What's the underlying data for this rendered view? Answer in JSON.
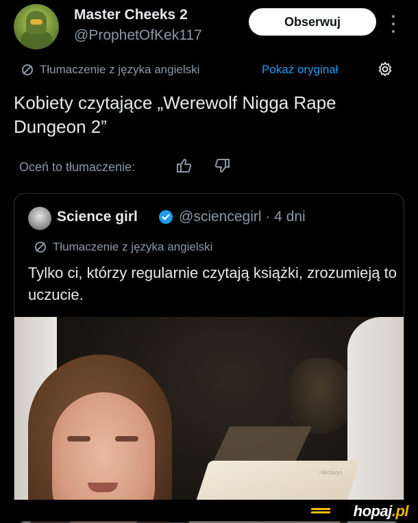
{
  "header": {
    "display_name": "Master Cheeks 2",
    "handle": "@ProphetOfKek117",
    "follow_label": "Obserwuj"
  },
  "translation_bar": {
    "label": "Tłumaczenie z języka angielski",
    "show_original_label": "Pokaż oryginał"
  },
  "tweet": {
    "text": "Kobiety czytające „Werewolf Nigga Rape Dungeon 2”"
  },
  "rating": {
    "label": "Oceń to tłumaczenie:"
  },
  "quoted_tweet": {
    "name": "Science girl",
    "handle_time": "@sciencegirl · 4 dni",
    "translation_label": "Tłumaczenie z języka angielski",
    "text": "Tylko ci, którzy regularnie czytają książki, zrozumieją to uczucie.",
    "media_watermark": "nikolwyx"
  },
  "footer": {
    "brand_main": "hopaj",
    "brand_suffix": ".pl"
  },
  "colors": {
    "background": "#000000",
    "text": "#e7e9ea",
    "muted": "#8b98a5",
    "link": "#1d9bf0",
    "verified": "#1d9bf0",
    "brand_accent": "#f5b800"
  }
}
